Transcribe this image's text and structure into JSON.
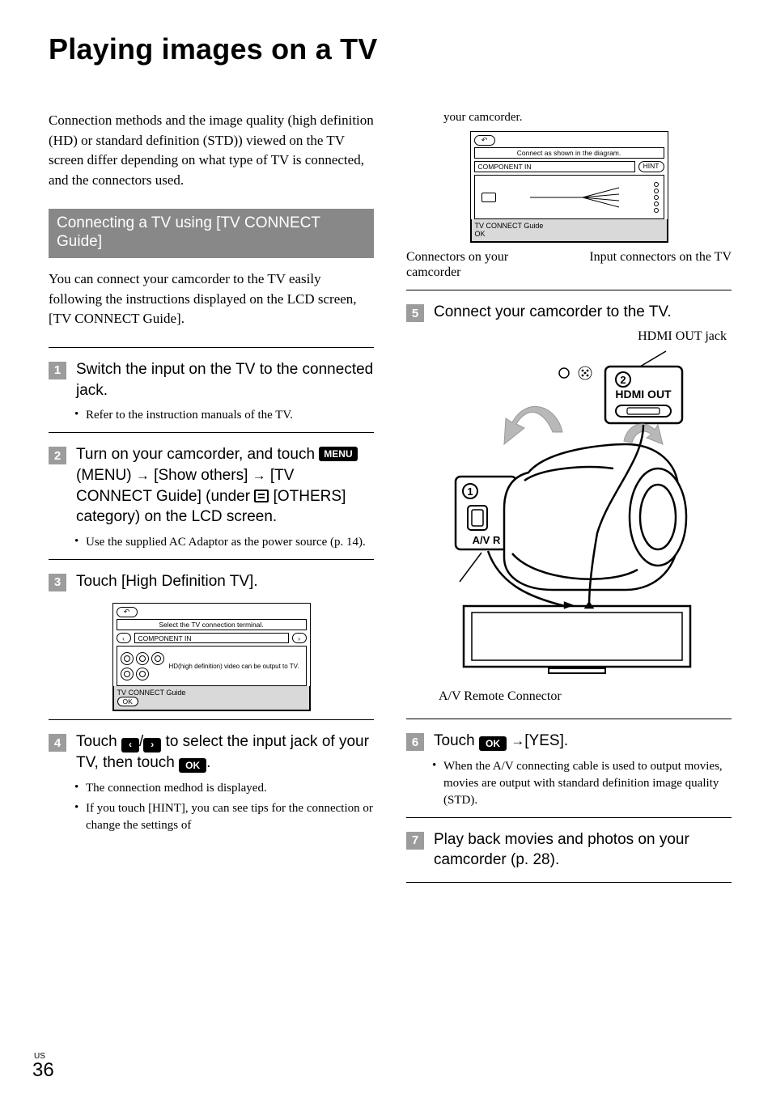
{
  "page": {
    "region": "US",
    "number": "36"
  },
  "title": "Playing images on a TV",
  "intro": "Connection methods and the image quality (high definition (HD) or standard definition (STD)) viewed on the TV screen differ depending on what type of TV is connected, and the connectors used.",
  "section": {
    "heading": "Connecting a TV using [TV CONNECT Guide]",
    "body": "You can connect your camcorder to the TV easily following the instructions displayed on the LCD screen, [TV CONNECT Guide]."
  },
  "steps": {
    "s1": {
      "num": "1",
      "text": "Switch the input on the TV to the connected jack.",
      "bullet1": "Refer to the instruction manuals of the TV."
    },
    "s2": {
      "num": "2",
      "text_a": "Turn on your camcorder, and touch ",
      "menu_badge": "MENU",
      "text_b": " (MENU) ",
      "text_c": " [Show others] ",
      "text_d": " [TV CONNECT Guide] (under ",
      "text_e": " [OTHERS] category) on the LCD screen.",
      "bullet1": "Use the supplied AC Adaptor as the power source (p. 14)."
    },
    "s3": {
      "num": "3",
      "text": "Touch [High Definition TV].",
      "lcd": {
        "title": "Select the TV connection terminal.",
        "tab": "COMPONENT IN",
        "desc": "HD(high definition) video can be output to TV.",
        "footer": "TV CONNECT Guide",
        "ok": "OK"
      }
    },
    "s4": {
      "num": "4",
      "text_a": "Touch ",
      "text_b": " to select the input jack of your TV, then touch ",
      "text_c": ".",
      "bullet1": "The connection medhod is displayed.",
      "bullet2": "If you touch [HINT], you can see tips for the connection or change the settings of",
      "cont": "your camcorder.",
      "lcd": {
        "title": "Connect as shown in the diagram.",
        "tab": "COMPONENT IN",
        "hint": "HINT",
        "footer": "TV CONNECT Guide",
        "ok": "OK"
      },
      "label_left": "Connectors on your camcorder",
      "label_right": "Input connectors on the TV"
    },
    "s5": {
      "num": "5",
      "text": "Connect your camcorder to the TV.",
      "label_hdmi": "HDMI OUT jack",
      "label_avr": "A/V Remote Connector",
      "port_hdmi": "HDMI OUT",
      "port_avr": "A/V R"
    },
    "s6": {
      "num": "6",
      "text_a": "Touch ",
      "ok": "OK",
      "text_b": "[YES].",
      "bullet1": "When the A/V connecting cable is used to output movies, movies are output with standard definition image quality (STD)."
    },
    "s7": {
      "num": "7",
      "text": "Play back movies and photos on your camcorder (p. 28)."
    }
  }
}
